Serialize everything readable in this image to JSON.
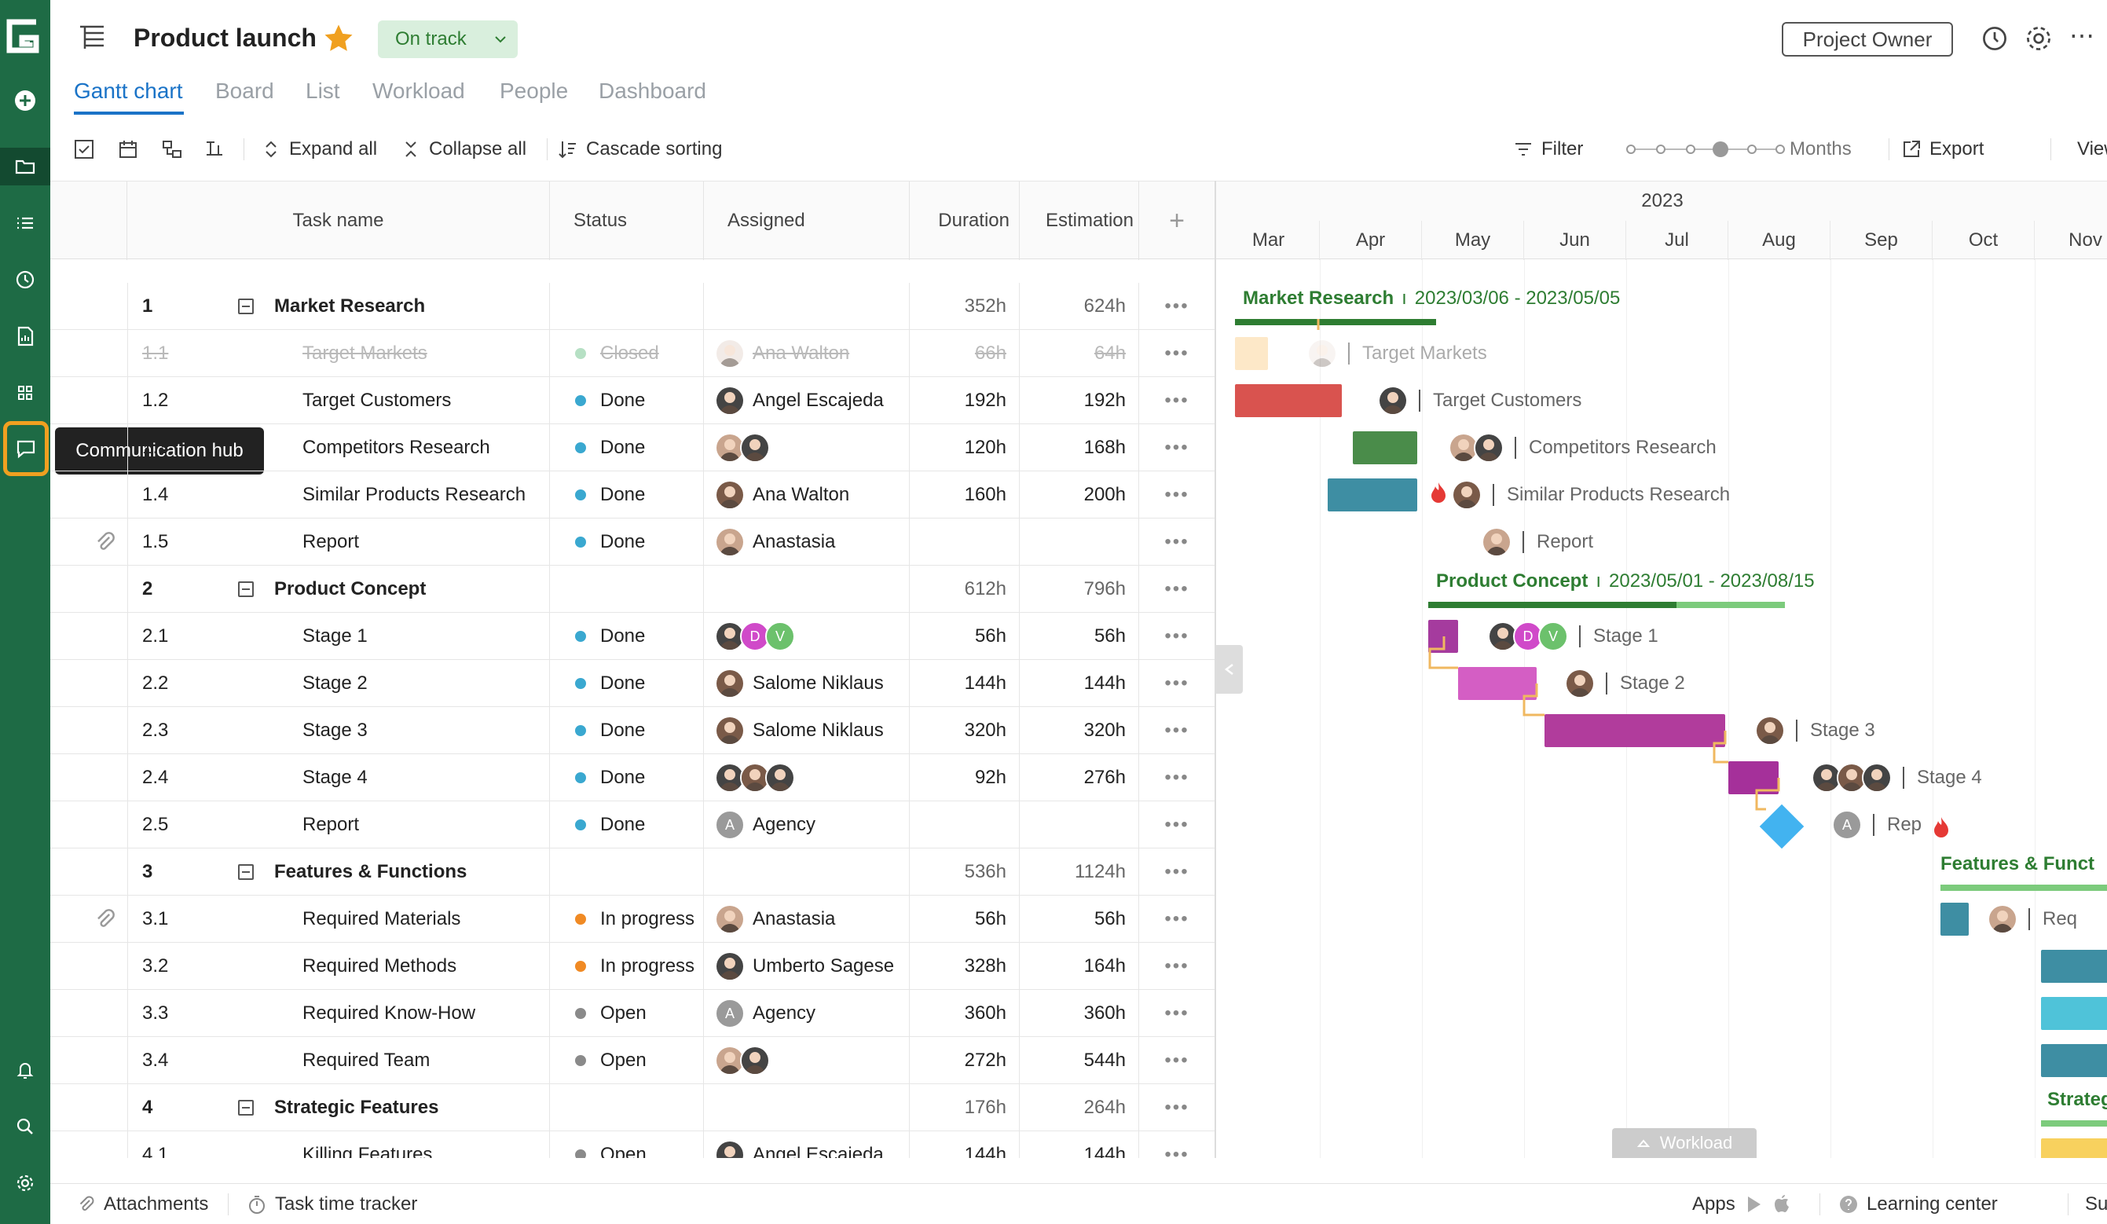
{
  "app": {
    "logo": "G"
  },
  "header": {
    "project_title": "Product launch",
    "status_label": "On track",
    "role_button": "Project Owner"
  },
  "tabs": [
    "Gantt chart",
    "Board",
    "List",
    "Workload",
    "People",
    "Dashboard"
  ],
  "toolbar": {
    "expand_all": "Expand all",
    "collapse_all": "Collapse all",
    "cascade_sorting": "Cascade sorting",
    "filter": "Filter",
    "zoom_unit": "Months",
    "export": "Export",
    "view": "View"
  },
  "tooltip": {
    "text": "Communication hub"
  },
  "columns": {
    "task_name": "Task name",
    "status": "Status",
    "assigned": "Assigned",
    "duration": "Duration",
    "estimation": "Estimation"
  },
  "rows": [
    {
      "num": "1",
      "name": "Market Research",
      "status": "",
      "assigned": "",
      "duration": "352h",
      "estimation": "624h",
      "summary": true
    },
    {
      "num": "1.1",
      "name": "Target Markets",
      "status": "Closed",
      "assigned": "Ana Walton",
      "duration": "66h",
      "estimation": "64h",
      "closed": true
    },
    {
      "num": "1.2",
      "name": "Target Customers",
      "status": "Done",
      "assigned": "Angel Escajeda",
      "duration": "192h",
      "estimation": "192h"
    },
    {
      "num": "1.3",
      "name": "Competitors Research",
      "status": "Done",
      "assigned": "",
      "duration": "120h",
      "estimation": "168h"
    },
    {
      "num": "1.4",
      "name": "Similar Products Research",
      "status": "Done",
      "assigned": "Ana Walton",
      "duration": "160h",
      "estimation": "200h"
    },
    {
      "num": "1.5",
      "name": "Report",
      "status": "Done",
      "assigned": "Anastasia",
      "duration": "",
      "estimation": "",
      "attach": true
    },
    {
      "num": "2",
      "name": "Product Concept",
      "status": "",
      "assigned": "",
      "duration": "612h",
      "estimation": "796h",
      "summary": true
    },
    {
      "num": "2.1",
      "name": "Stage 1",
      "status": "Done",
      "assigned": "",
      "duration": "56h",
      "estimation": "56h"
    },
    {
      "num": "2.2",
      "name": "Stage 2",
      "status": "Done",
      "assigned": "Salome Niklaus",
      "duration": "144h",
      "estimation": "144h"
    },
    {
      "num": "2.3",
      "name": "Stage 3",
      "status": "Done",
      "assigned": "Salome Niklaus",
      "duration": "320h",
      "estimation": "320h"
    },
    {
      "num": "2.4",
      "name": "Stage 4",
      "status": "Done",
      "assigned": "",
      "duration": "92h",
      "estimation": "276h"
    },
    {
      "num": "2.5",
      "name": "Report",
      "status": "Done",
      "assigned": "Agency",
      "duration": "",
      "estimation": ""
    },
    {
      "num": "3",
      "name": "Features & Functions",
      "status": "",
      "assigned": "",
      "duration": "536h",
      "estimation": "1124h",
      "summary": true
    },
    {
      "num": "3.1",
      "name": "Required Materials",
      "status": "In progress",
      "assigned": "Anastasia",
      "duration": "56h",
      "estimation": "56h",
      "attach": true
    },
    {
      "num": "3.2",
      "name": "Required Methods",
      "status": "In progress",
      "assigned": "Umberto Sagese",
      "duration": "328h",
      "estimation": "164h"
    },
    {
      "num": "3.3",
      "name": "Required Know-How",
      "status": "Open",
      "assigned": "Agency",
      "duration": "360h",
      "estimation": "360h"
    },
    {
      "num": "3.4",
      "name": "Required Team",
      "status": "Open",
      "assigned": "",
      "duration": "272h",
      "estimation": "544h"
    },
    {
      "num": "4",
      "name": "Strategic Features",
      "status": "",
      "assigned": "",
      "duration": "176h",
      "estimation": "264h",
      "summary": true
    },
    {
      "num": "4.1",
      "name": "Killing Features",
      "status": "Open",
      "assigned": "Angel Escajeda",
      "duration": "144h",
      "estimation": "144h"
    }
  ],
  "timeline": {
    "year": "2023",
    "months": [
      "Mar",
      "Apr",
      "May",
      "Jun",
      "Jul",
      "Aug",
      "Sep",
      "Oct",
      "Nov"
    ],
    "labels": {
      "market_research": "Market Research",
      "market_dates": "2023/03/06 - 2023/05/05",
      "target_markets": "Target Markets",
      "target_customers": "Target Customers",
      "competitors": "Competitors Research",
      "similar": "Similar Products Research",
      "report1": "Report",
      "product_concept": "Product Concept",
      "concept_dates": "2023/05/01 - 2023/08/15",
      "stage1": "Stage 1",
      "stage2": "Stage 2",
      "stage3": "Stage 3",
      "stage4": "Stage 4",
      "report2": "Rep",
      "features": "Features & Funct",
      "req": "Req",
      "strategic": "Strateg"
    },
    "workload_label": "Workload"
  },
  "avatar_initials": {
    "d": "D",
    "v": "V",
    "a": "A"
  },
  "footer": {
    "attachments": "Attachments",
    "time_tracker": "Task time tracker",
    "apps": "Apps",
    "learning": "Learning center",
    "support": "Support"
  },
  "colors": {
    "sidebar": "#1e6b45",
    "accent": "#1a73c7",
    "status_done": "#3aa8d0",
    "status_progress": "#f08a24",
    "status_open": "#8a8a8a",
    "status_closed": "#b6e0c4",
    "highlight": "#f0a020"
  }
}
